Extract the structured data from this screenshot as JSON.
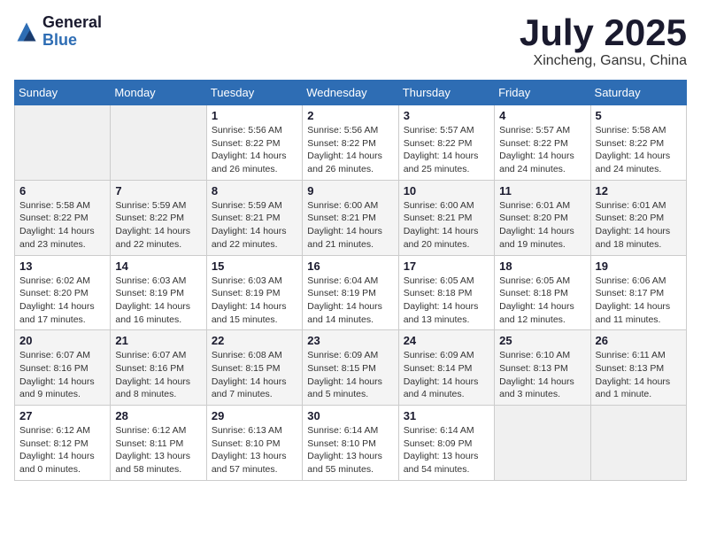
{
  "header": {
    "logo_general": "General",
    "logo_blue": "Blue",
    "title": "July 2025",
    "location": "Xincheng, Gansu, China"
  },
  "days_of_week": [
    "Sunday",
    "Monday",
    "Tuesday",
    "Wednesday",
    "Thursday",
    "Friday",
    "Saturday"
  ],
  "weeks": [
    [
      {
        "day": "",
        "info": ""
      },
      {
        "day": "",
        "info": ""
      },
      {
        "day": "1",
        "info": "Sunrise: 5:56 AM\nSunset: 8:22 PM\nDaylight: 14 hours and 26 minutes."
      },
      {
        "day": "2",
        "info": "Sunrise: 5:56 AM\nSunset: 8:22 PM\nDaylight: 14 hours and 26 minutes."
      },
      {
        "day": "3",
        "info": "Sunrise: 5:57 AM\nSunset: 8:22 PM\nDaylight: 14 hours and 25 minutes."
      },
      {
        "day": "4",
        "info": "Sunrise: 5:57 AM\nSunset: 8:22 PM\nDaylight: 14 hours and 24 minutes."
      },
      {
        "day": "5",
        "info": "Sunrise: 5:58 AM\nSunset: 8:22 PM\nDaylight: 14 hours and 24 minutes."
      }
    ],
    [
      {
        "day": "6",
        "info": "Sunrise: 5:58 AM\nSunset: 8:22 PM\nDaylight: 14 hours and 23 minutes."
      },
      {
        "day": "7",
        "info": "Sunrise: 5:59 AM\nSunset: 8:22 PM\nDaylight: 14 hours and 22 minutes."
      },
      {
        "day": "8",
        "info": "Sunrise: 5:59 AM\nSunset: 8:21 PM\nDaylight: 14 hours and 22 minutes."
      },
      {
        "day": "9",
        "info": "Sunrise: 6:00 AM\nSunset: 8:21 PM\nDaylight: 14 hours and 21 minutes."
      },
      {
        "day": "10",
        "info": "Sunrise: 6:00 AM\nSunset: 8:21 PM\nDaylight: 14 hours and 20 minutes."
      },
      {
        "day": "11",
        "info": "Sunrise: 6:01 AM\nSunset: 8:20 PM\nDaylight: 14 hours and 19 minutes."
      },
      {
        "day": "12",
        "info": "Sunrise: 6:01 AM\nSunset: 8:20 PM\nDaylight: 14 hours and 18 minutes."
      }
    ],
    [
      {
        "day": "13",
        "info": "Sunrise: 6:02 AM\nSunset: 8:20 PM\nDaylight: 14 hours and 17 minutes."
      },
      {
        "day": "14",
        "info": "Sunrise: 6:03 AM\nSunset: 8:19 PM\nDaylight: 14 hours and 16 minutes."
      },
      {
        "day": "15",
        "info": "Sunrise: 6:03 AM\nSunset: 8:19 PM\nDaylight: 14 hours and 15 minutes."
      },
      {
        "day": "16",
        "info": "Sunrise: 6:04 AM\nSunset: 8:19 PM\nDaylight: 14 hours and 14 minutes."
      },
      {
        "day": "17",
        "info": "Sunrise: 6:05 AM\nSunset: 8:18 PM\nDaylight: 14 hours and 13 minutes."
      },
      {
        "day": "18",
        "info": "Sunrise: 6:05 AM\nSunset: 8:18 PM\nDaylight: 14 hours and 12 minutes."
      },
      {
        "day": "19",
        "info": "Sunrise: 6:06 AM\nSunset: 8:17 PM\nDaylight: 14 hours and 11 minutes."
      }
    ],
    [
      {
        "day": "20",
        "info": "Sunrise: 6:07 AM\nSunset: 8:16 PM\nDaylight: 14 hours and 9 minutes."
      },
      {
        "day": "21",
        "info": "Sunrise: 6:07 AM\nSunset: 8:16 PM\nDaylight: 14 hours and 8 minutes."
      },
      {
        "day": "22",
        "info": "Sunrise: 6:08 AM\nSunset: 8:15 PM\nDaylight: 14 hours and 7 minutes."
      },
      {
        "day": "23",
        "info": "Sunrise: 6:09 AM\nSunset: 8:15 PM\nDaylight: 14 hours and 5 minutes."
      },
      {
        "day": "24",
        "info": "Sunrise: 6:09 AM\nSunset: 8:14 PM\nDaylight: 14 hours and 4 minutes."
      },
      {
        "day": "25",
        "info": "Sunrise: 6:10 AM\nSunset: 8:13 PM\nDaylight: 14 hours and 3 minutes."
      },
      {
        "day": "26",
        "info": "Sunrise: 6:11 AM\nSunset: 8:13 PM\nDaylight: 14 hours and 1 minute."
      }
    ],
    [
      {
        "day": "27",
        "info": "Sunrise: 6:12 AM\nSunset: 8:12 PM\nDaylight: 14 hours and 0 minutes."
      },
      {
        "day": "28",
        "info": "Sunrise: 6:12 AM\nSunset: 8:11 PM\nDaylight: 13 hours and 58 minutes."
      },
      {
        "day": "29",
        "info": "Sunrise: 6:13 AM\nSunset: 8:10 PM\nDaylight: 13 hours and 57 minutes."
      },
      {
        "day": "30",
        "info": "Sunrise: 6:14 AM\nSunset: 8:10 PM\nDaylight: 13 hours and 55 minutes."
      },
      {
        "day": "31",
        "info": "Sunrise: 6:14 AM\nSunset: 8:09 PM\nDaylight: 13 hours and 54 minutes."
      },
      {
        "day": "",
        "info": ""
      },
      {
        "day": "",
        "info": ""
      }
    ]
  ]
}
